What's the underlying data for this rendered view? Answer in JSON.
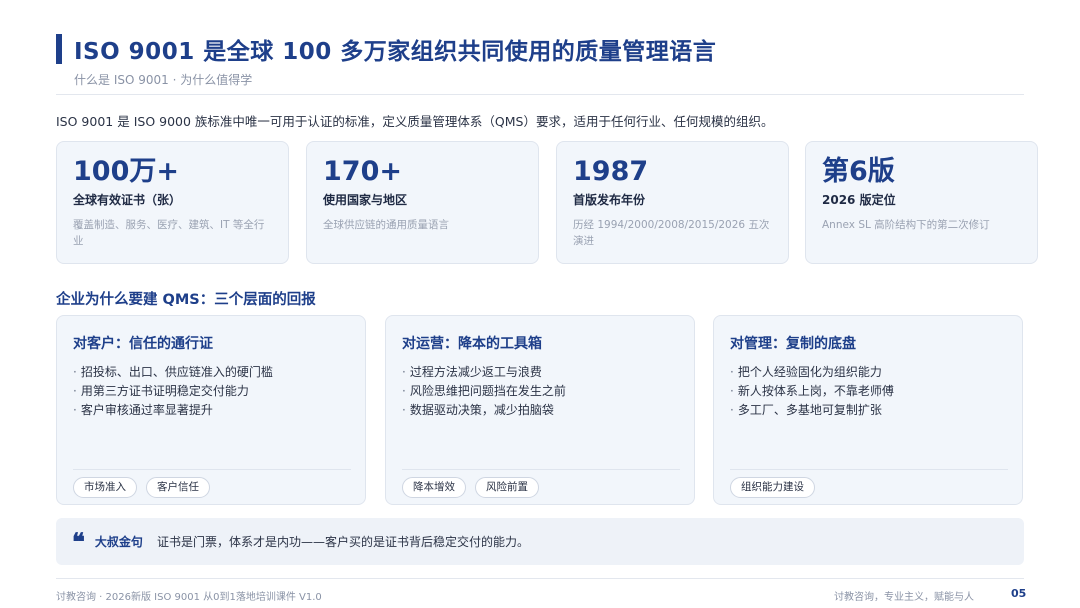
{
  "header": {
    "title": "ISO 9001 是全球 100 多万家组织共同使用的质量管理语言",
    "subtitle": "什么是 ISO 9001 · 为什么值得学"
  },
  "intro": "ISO 9001 是 ISO 9000 族标准中唯一可用于认证的标准，定义质量管理体系（QMS）要求，适用于任何行业、任何规模的组织。",
  "stats": [
    {
      "value": "100万+",
      "label": "全球有效证书（张）",
      "desc": "覆盖制造、服务、医疗、建筑、IT 等全行业"
    },
    {
      "value": "170+",
      "label": "使用国家与地区",
      "desc": "全球供应链的通用质量语言"
    },
    {
      "value": "1987",
      "label": "首版发布年份",
      "desc": "历经 1994/2000/2008/2015/2026 五次演进"
    },
    {
      "value": "第6版",
      "label": "2026 版定位",
      "desc": "Annex SL 高阶结构下的第二次修订"
    }
  ],
  "section_title": "企业为什么要建 QMS：三个层面的回报",
  "cards": [
    {
      "title": "对客户：信任的通行证",
      "items": [
        "招投标、出口、供应链准入的硬门槛",
        "用第三方证书证明稳定交付能力",
        "客户审核通过率显著提升"
      ],
      "tags": [
        "市场准入",
        "客户信任"
      ]
    },
    {
      "title": "对运营：降本的工具箱",
      "items": [
        "过程方法减少返工与浪费",
        "风险思维把问题挡在发生之前",
        "数据驱动决策，减少拍脑袋"
      ],
      "tags": [
        "降本增效",
        "风险前置"
      ]
    },
    {
      "title": "对管理：复制的底盘",
      "items": [
        "把个人经验固化为组织能力",
        "新人按体系上岗，不靠老师傅",
        "多工厂、多基地可复制扩张"
      ],
      "tags": [
        "组织能力建设"
      ]
    }
  ],
  "quote": {
    "icon": "quote-icon",
    "mark": "❝",
    "label": "大叔金句",
    "text": "证书是门票，体系才是内功——客户买的是证书背后稳定交付的能力。"
  },
  "footer": {
    "left": "讨教咨询 · 2026新版 ISO 9001 从0到1落地培训课件 V1.0",
    "right": "讨教咨询，专业主义，赋能与人",
    "page": "05"
  },
  "colors": {
    "accent": "#1e3f8a",
    "card_bg": "#f2f6fb",
    "muted": "#8a93a6"
  }
}
